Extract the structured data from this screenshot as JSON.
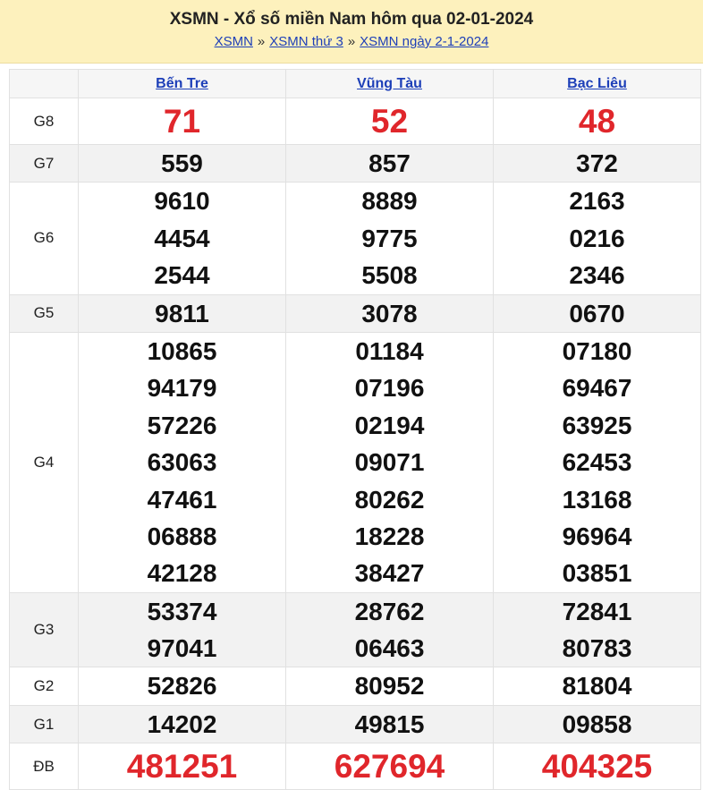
{
  "header": {
    "title": "XSMN - Xổ số miền Nam hôm qua 02-01-2024",
    "crumbs": [
      "XSMN",
      "XSMN thứ 3",
      "XSMN ngày 2-1-2024"
    ],
    "separator": "»"
  },
  "provinces": [
    "Bến Tre",
    "Vũng Tàu",
    "Bạc Liêu"
  ],
  "prizes": [
    {
      "label": "G8",
      "results": [
        [
          "71"
        ],
        [
          "52"
        ],
        [
          "48"
        ]
      ]
    },
    {
      "label": "G7",
      "results": [
        [
          "559"
        ],
        [
          "857"
        ],
        [
          "372"
        ]
      ]
    },
    {
      "label": "G6",
      "results": [
        [
          "9610",
          "4454",
          "2544"
        ],
        [
          "8889",
          "9775",
          "5508"
        ],
        [
          "2163",
          "0216",
          "2346"
        ]
      ]
    },
    {
      "label": "G5",
      "results": [
        [
          "9811"
        ],
        [
          "3078"
        ],
        [
          "0670"
        ]
      ]
    },
    {
      "label": "G4",
      "results": [
        [
          "10865",
          "94179",
          "57226",
          "63063",
          "47461",
          "06888",
          "42128"
        ],
        [
          "01184",
          "07196",
          "02194",
          "09071",
          "80262",
          "18228",
          "38427"
        ],
        [
          "07180",
          "69467",
          "63925",
          "62453",
          "13168",
          "96964",
          "03851"
        ]
      ]
    },
    {
      "label": "G3",
      "results": [
        [
          "53374",
          "97041"
        ],
        [
          "28762",
          "06463"
        ],
        [
          "72841",
          "80783"
        ]
      ]
    },
    {
      "label": "G2",
      "results": [
        [
          "52826"
        ],
        [
          "80952"
        ],
        [
          "81804"
        ]
      ]
    },
    {
      "label": "G1",
      "results": [
        [
          "14202"
        ],
        [
          "49815"
        ],
        [
          "09858"
        ]
      ]
    },
    {
      "label": "ĐB",
      "results": [
        [
          "481251"
        ],
        [
          "627694"
        ],
        [
          "404325"
        ]
      ]
    }
  ],
  "colors": {
    "highlight": "#e0262b",
    "link": "#1d3fb8",
    "header_bg": "#fdf1bd"
  }
}
